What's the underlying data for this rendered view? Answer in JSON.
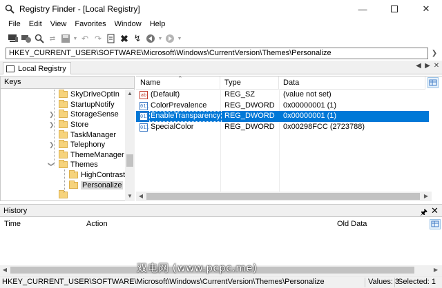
{
  "window": {
    "title": "Registry Finder - [Local Registry]",
    "controls": [
      "minimize-icon",
      "maximize-icon",
      "close-icon"
    ]
  },
  "menu": [
    "File",
    "Edit",
    "View",
    "Favorites",
    "Window",
    "Help"
  ],
  "toolbar": {
    "icons": [
      "computer-icon",
      "connect-icon",
      "find-icon",
      "replace-icon",
      "save-icon",
      "undo-icon",
      "redo-icon",
      "delete-icon",
      "refresh-icon",
      "back-icon",
      "forward-icon"
    ]
  },
  "address": {
    "value": "HKEY_CURRENT_USER\\SOFTWARE\\Microsoft\\Windows\\CurrentVersion\\Themes\\Personalize"
  },
  "tab": {
    "label": "Local Registry"
  },
  "keys_pane": {
    "title": "Keys",
    "items": [
      {
        "label": "SkyDriveOptIn",
        "expandable": false
      },
      {
        "label": "StartupNotify",
        "expandable": false
      },
      {
        "label": "StorageSense",
        "expandable": true
      },
      {
        "label": "Store",
        "expandable": true
      },
      {
        "label": "TaskManager",
        "expandable": false
      },
      {
        "label": "Telephony",
        "expandable": true
      },
      {
        "label": "ThemeManager",
        "expandable": false
      },
      {
        "label": "Themes",
        "expandable": true,
        "expanded": true
      },
      {
        "label": "HighContrast",
        "expandable": false,
        "child": true
      },
      {
        "label": "Personalize",
        "expandable": false,
        "child": true,
        "selected": true
      }
    ]
  },
  "values_pane": {
    "columns": [
      "Name",
      "Type",
      "Data"
    ],
    "rows": [
      {
        "name": "(Default)",
        "type": "REG_SZ",
        "data": "(value not set)",
        "icon": "ab",
        "selected": false
      },
      {
        "name": "ColorPrevalence",
        "type": "REG_DWORD",
        "data": "0x00000001 (1)",
        "icon": "011",
        "selected": false
      },
      {
        "name": "EnableTransparency",
        "type": "REG_DWORD",
        "data": "0x00000001 (1)",
        "icon": "011",
        "selected": true
      },
      {
        "name": "SpecialColor",
        "type": "REG_DWORD",
        "data": "0x00298FCC (2723788)",
        "icon": "011",
        "selected": false
      }
    ]
  },
  "history": {
    "title": "History",
    "columns": [
      "Time",
      "Action",
      "Old Data"
    ]
  },
  "status": {
    "path": "HKEY_CURRENT_USER\\SOFTWARE\\Microsoft\\Windows\\CurrentVersion\\Themes\\Personalize",
    "values": "Values: 3",
    "selected": "Selected: 1"
  },
  "watermark": "双电网 (www.pcpc.me)",
  "colors": {
    "selection": "#0078d7",
    "folder": "#f6d37c"
  }
}
